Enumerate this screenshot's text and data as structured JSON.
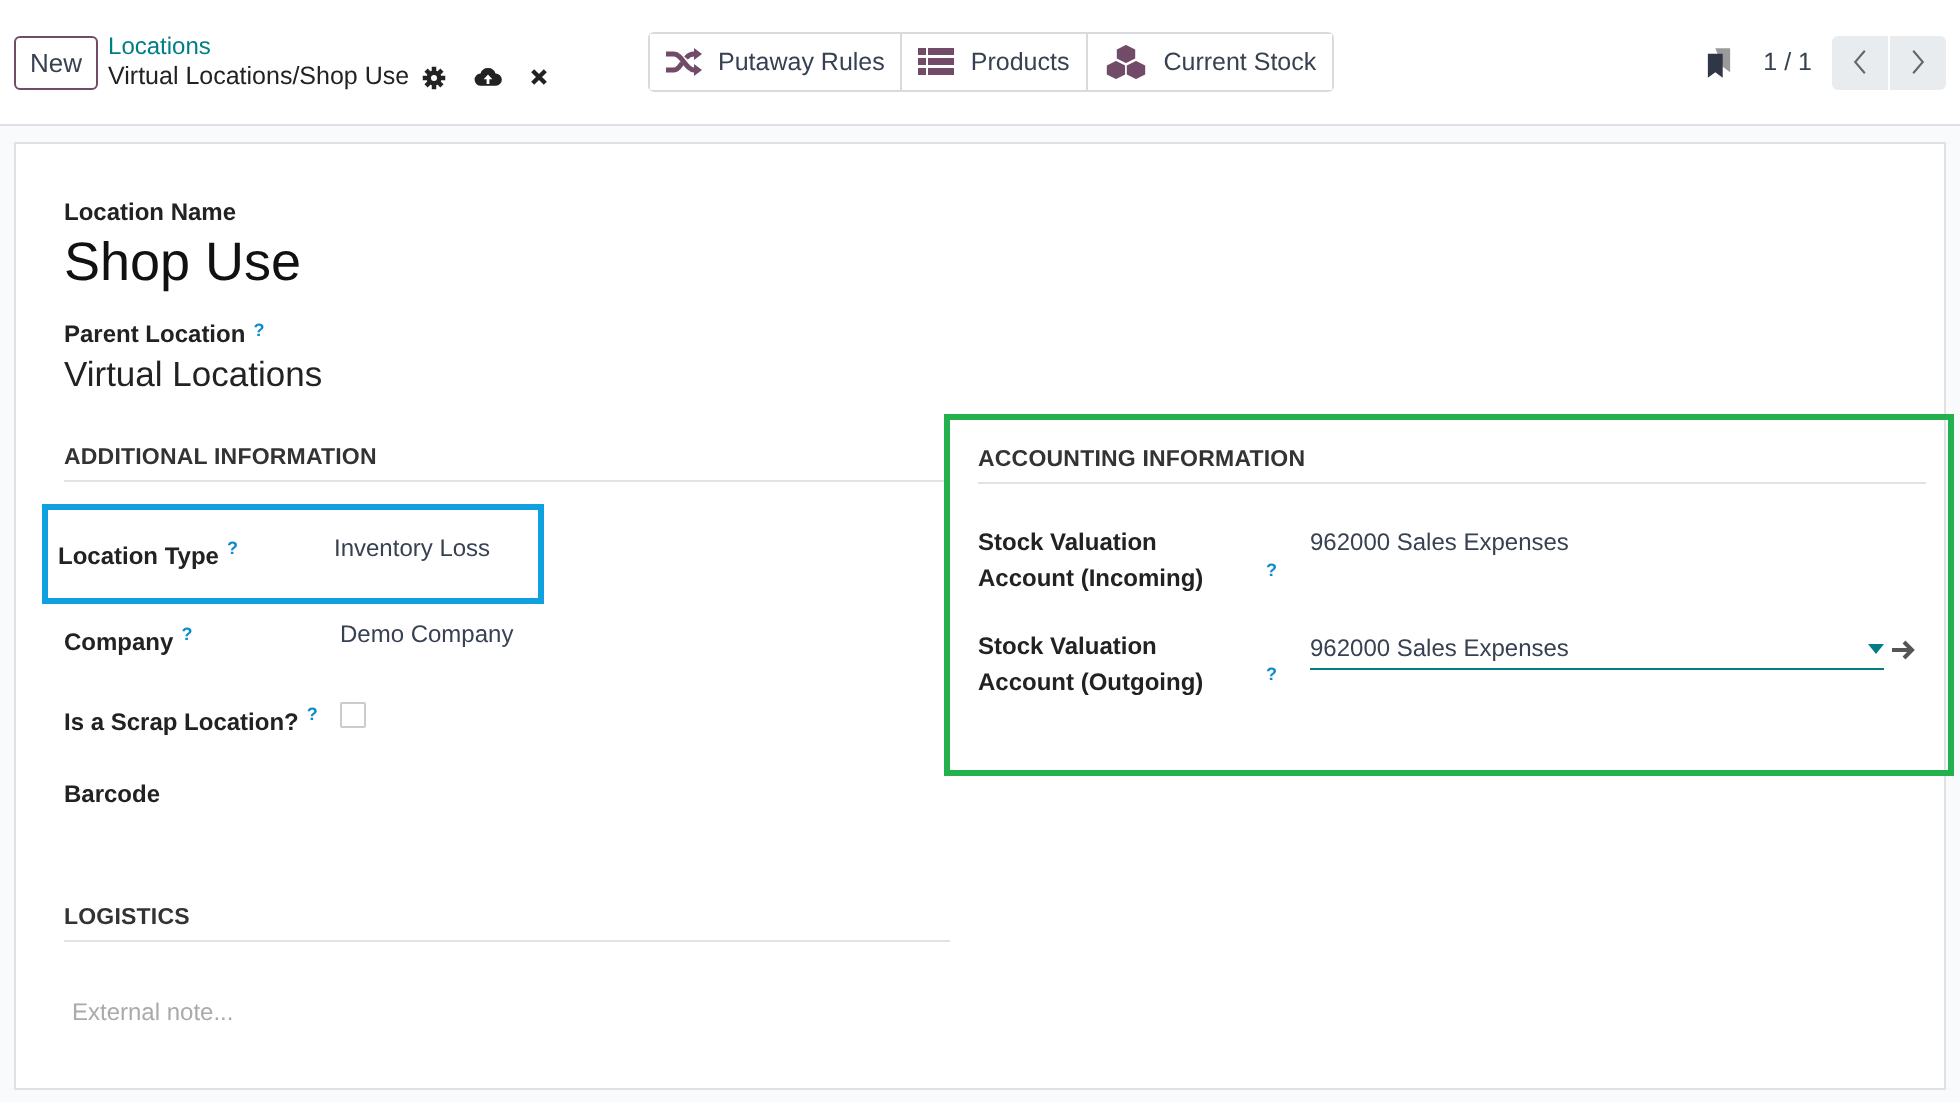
{
  "control_panel": {
    "new_button": "New",
    "breadcrumb": "Locations",
    "record_title": "Virtual Locations/Shop Use",
    "smart_buttons": [
      {
        "kind": "shuffle",
        "label": "Putaway Rules"
      },
      {
        "kind": "list",
        "label": "Products"
      },
      {
        "kind": "cubes",
        "label": "Current Stock"
      }
    ],
    "pager": "1 / 1"
  },
  "form": {
    "name_label": "Location Name",
    "name": "Shop Use",
    "parent_label": "Parent Location",
    "parent_help": "?",
    "parent": "Virtual Locations",
    "groups": [
      {
        "title": "ADDITIONAL INFORMATION",
        "fields": [
          {
            "kind": "text",
            "label": "Location Type",
            "help": "?",
            "value": "Inventory Loss",
            "color": "#0fa0e0"
          },
          {
            "kind": "text",
            "label": "Company",
            "help": "?",
            "value": "Demo Company"
          },
          {
            "kind": "checkbox",
            "label": "Is a Scrap Location?",
            "help": "?",
            "checked": false
          },
          {
            "kind": "empty",
            "label": "Barcode"
          }
        ]
      },
      {
        "title": "ACCOUNTING INFORMATION",
        "color": "#22b14c",
        "fields": [
          {
            "kind": "text",
            "label": "Stock Valuation Account (Incoming)",
            "help": "?",
            "value": "962000 Sales Expenses"
          },
          {
            "kind": "select",
            "label": "Stock Valuation Account (Outgoing)",
            "help": "?",
            "value": "962000 Sales Expenses"
          }
        ]
      }
    ],
    "logistics_title": "LOGISTICS",
    "note_placeholder": "External note..."
  }
}
